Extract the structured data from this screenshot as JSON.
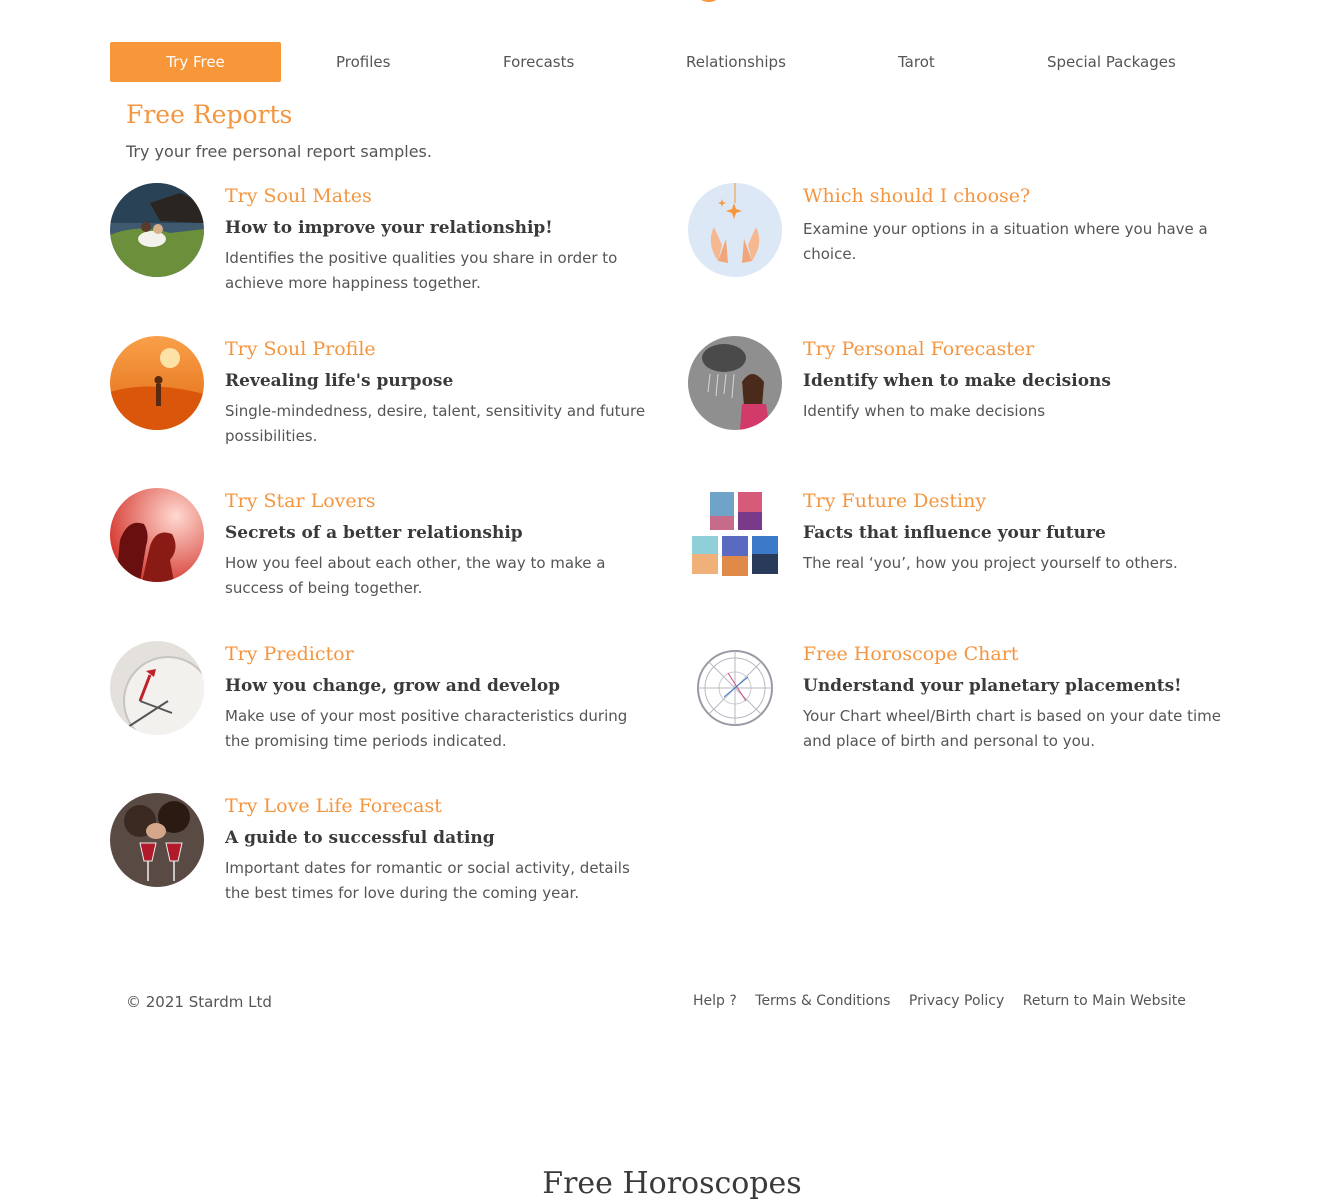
{
  "colors": {
    "accent": "#f8963a",
    "heading": "#f4953f",
    "text": "#555555",
    "dark": "#3a3a3a"
  },
  "nav": {
    "items": [
      {
        "label": "Try Free",
        "active": true
      },
      {
        "label": "Profiles"
      },
      {
        "label": "Forecasts"
      },
      {
        "label": "Relationships"
      },
      {
        "label": "Tarot"
      },
      {
        "label": "Special Packages"
      }
    ]
  },
  "main": {
    "title": "Free Reports",
    "subtitle": "Try your free personal report samples."
  },
  "reports": [
    {
      "title": "Try Soul Mates",
      "tagline": "How to improve your relationship!",
      "description": "Identifies the positive qualities you share in order to achieve more happiness together.",
      "image": "couple-by-sea-image"
    },
    {
      "title": "Which should I choose?",
      "tagline": "",
      "description": "Examine your options in a situation where you have a choice.",
      "image": "hands-sparkle-image"
    },
    {
      "title": "Try Soul Profile",
      "tagline": "Revealing life's purpose",
      "description": "Single-mindedness, desire, talent, sensitivity and future possibilities.",
      "image": "desert-walker-image"
    },
    {
      "title": "Try Personal Forecaster",
      "tagline": "Identify when to make decisions",
      "description": "Identify when to make decisions",
      "image": "woman-under-cloud-image"
    },
    {
      "title": "Try Star Lovers",
      "tagline": "Secrets of a better relationship",
      "description": "How you feel about each other, the way to make a success of being together.",
      "image": "kissing-silhouette-image"
    },
    {
      "title": "Try Future Destiny",
      "tagline": "Facts that influence your future",
      "description": "The real ‘you’, how you project yourself to others.",
      "image": "book-covers-image"
    },
    {
      "title": "Try Predictor",
      "tagline": "How you change, grow and develop",
      "description": "Make use of your most positive characteristics during the promising time periods indicated.",
      "image": "future-compass-image"
    },
    {
      "title": "Free Horoscope Chart",
      "tagline": "Understand your planetary placements!",
      "description": "Your Chart wheel/Birth chart is based on your date time and place of birth and personal to you.",
      "image": "chart-wheel-image"
    },
    {
      "title": "Try Love Life Forecast",
      "tagline": "A guide to successful dating",
      "description": "Important dates for romantic or social activity, details the best times for love during the coming year.",
      "image": "wine-couple-image"
    }
  ],
  "footer": {
    "copyright": "© 2021 Stardm Ltd",
    "links": [
      "Help ?",
      "Terms & Conditions",
      "Privacy Policy",
      "Return to Main Website"
    ]
  },
  "next_section": {
    "title": "Free Horoscopes"
  }
}
